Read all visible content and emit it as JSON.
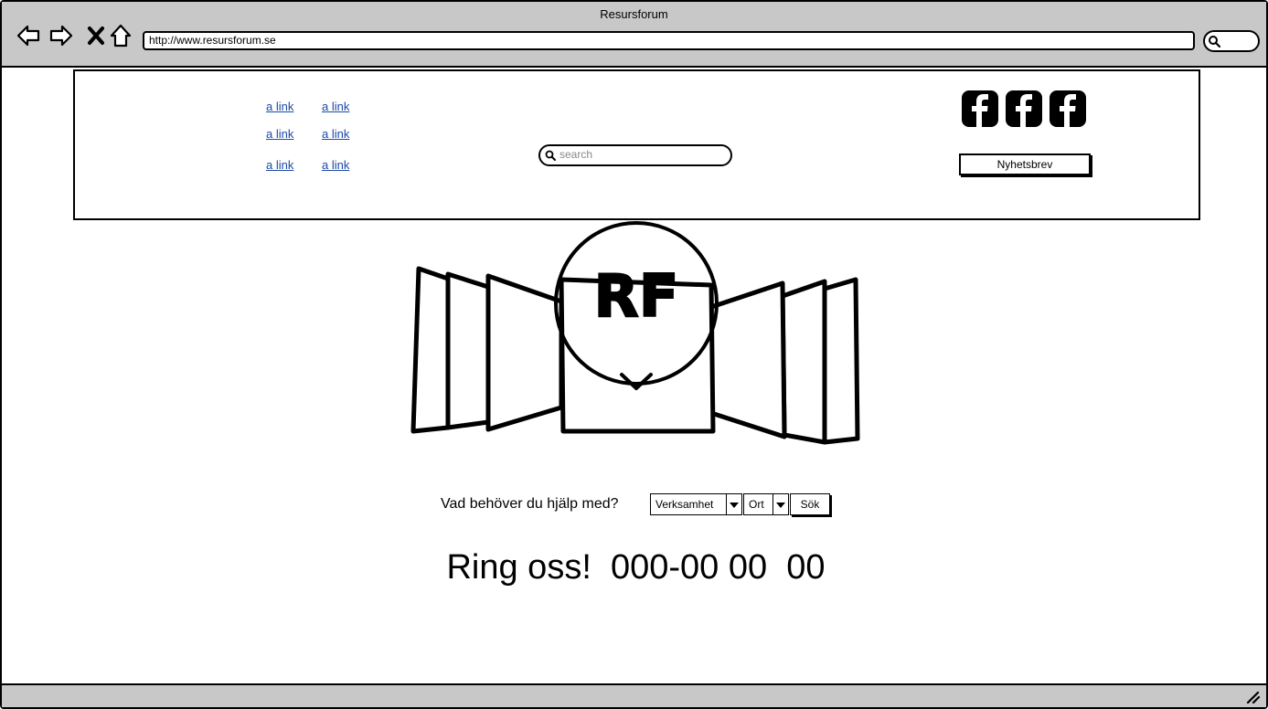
{
  "window": {
    "title": "Resursforum",
    "url": "http://www.resursforum.se"
  },
  "header": {
    "links": [
      "a link",
      "a link",
      "a link",
      "a link",
      "a link",
      "a link"
    ],
    "search_placeholder": "search",
    "newsletter_label": "Nyhetsbrev",
    "social_icons": [
      "facebook-icon",
      "facebook-icon",
      "facebook-icon"
    ]
  },
  "hero": {
    "logo_text": "RF"
  },
  "help": {
    "question": "Vad behöver du hjälp med?",
    "verksamhet": "Verksamhet",
    "ort": "Ort",
    "search_button": "Sök"
  },
  "contact": {
    "text": "Ring oss!  000-00 00  00"
  }
}
